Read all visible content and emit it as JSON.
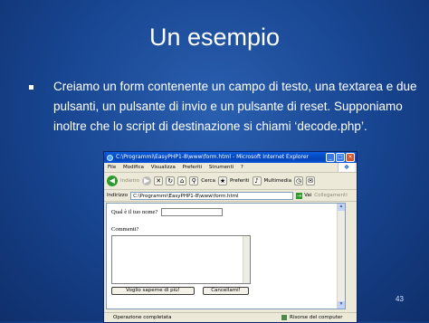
{
  "slide": {
    "title": "Un esempio",
    "bullet": "Creiamo un form contenente un campo di testo, una textarea e due pulsanti, un pulsante di invio e un pulsante di reset. Supponiamo inoltre che lo script di destinazione si chiami ‘decode.php’.",
    "page_number": "43"
  },
  "browser": {
    "title": "C:\\Programmi\\EasyPHP1-8\\www\\form.html - Microsoft Internet Explorer",
    "menu": [
      "File",
      "Modifica",
      "Visualizza",
      "Preferiti",
      "Strumenti",
      "?"
    ],
    "toolbar": {
      "back": "Indietro",
      "search": "Cerca",
      "favorites": "Preferiti",
      "multimedia": "Multimedia"
    },
    "address": {
      "label": "Indirizzo",
      "value": "C:\\Programmi\\EasyPHP1-8\\www\\form.html",
      "go": "Vai",
      "links": "Collegamenti"
    },
    "page": {
      "name_question": "Qual è il tuo nome?",
      "comments_label": "Commenti?",
      "submit_label": "Voglio saperne di più!",
      "reset_label": "Cancellami!"
    },
    "status": {
      "left": "Operazione completata",
      "right": "Risorse del computer"
    }
  }
}
